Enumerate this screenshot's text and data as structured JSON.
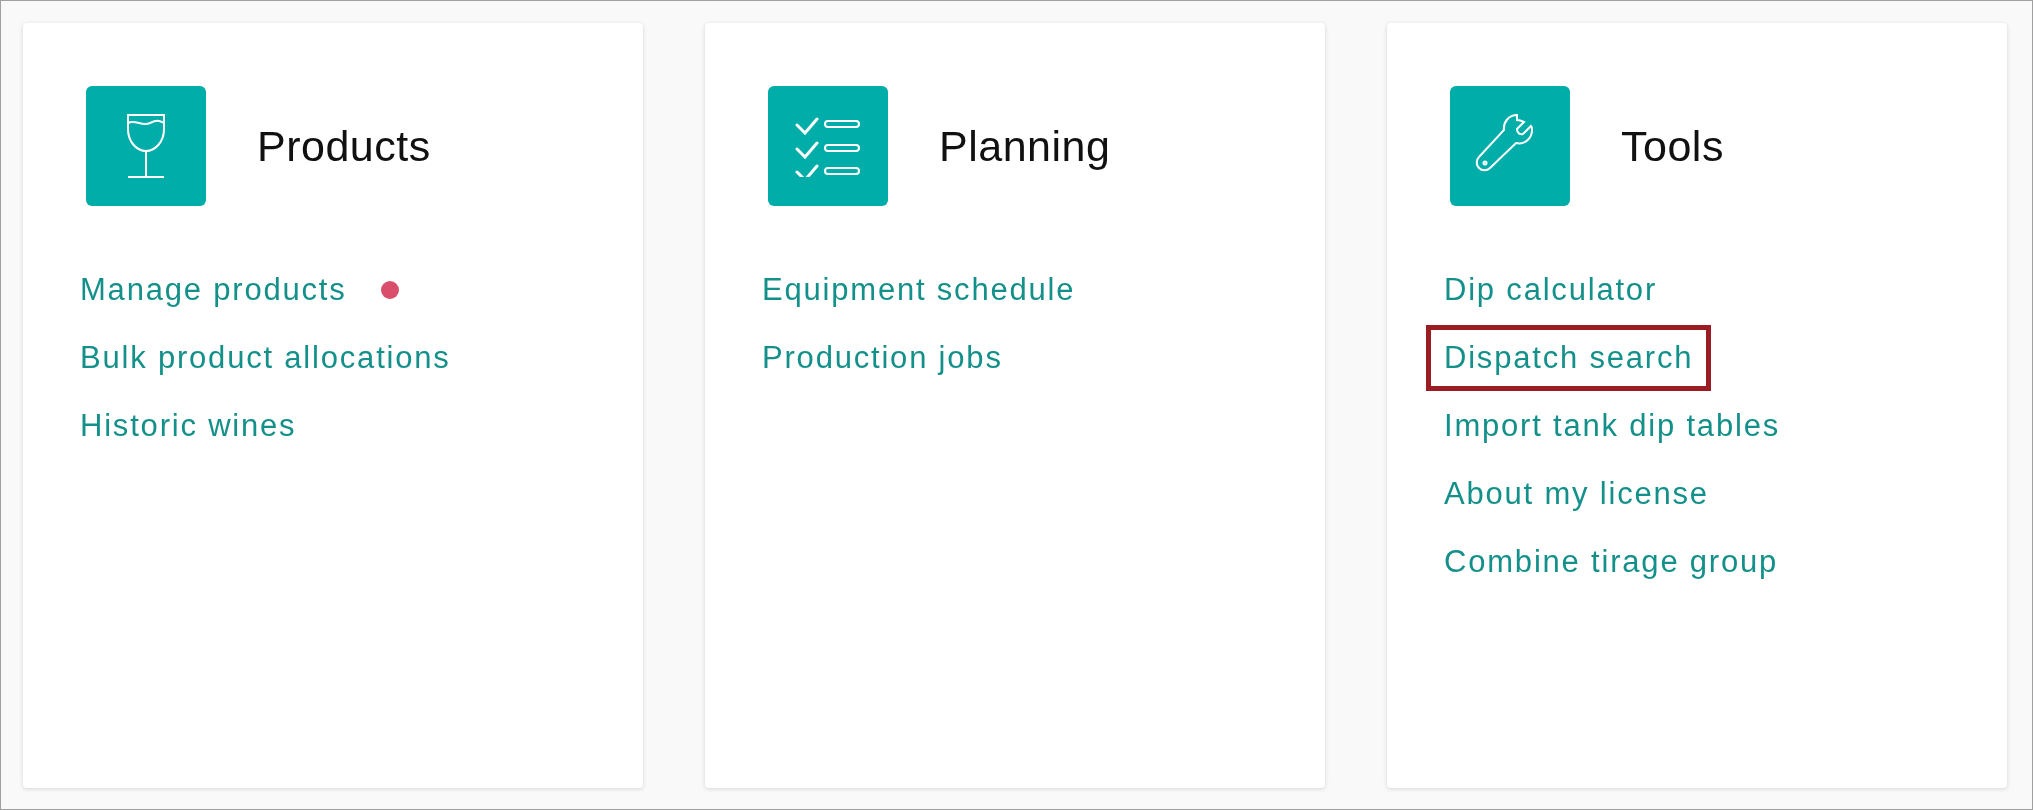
{
  "cards": [
    {
      "title": "Products",
      "links": [
        {
          "label": "Manage products",
          "notification": true,
          "highlighted": false
        },
        {
          "label": "Bulk product allocations",
          "notification": false,
          "highlighted": false
        },
        {
          "label": "Historic wines",
          "notification": false,
          "highlighted": false
        }
      ]
    },
    {
      "title": "Planning",
      "links": [
        {
          "label": "Equipment schedule",
          "notification": false,
          "highlighted": false
        },
        {
          "label": "Production jobs",
          "notification": false,
          "highlighted": false
        }
      ]
    },
    {
      "title": "Tools",
      "links": [
        {
          "label": "Dip calculator",
          "notification": false,
          "highlighted": false
        },
        {
          "label": "Dispatch search",
          "notification": false,
          "highlighted": true
        },
        {
          "label": "Import tank dip tables",
          "notification": false,
          "highlighted": false
        },
        {
          "label": "About my license",
          "notification": false,
          "highlighted": false
        },
        {
          "label": "Combine tirage group",
          "notification": false,
          "highlighted": false
        }
      ]
    }
  ]
}
